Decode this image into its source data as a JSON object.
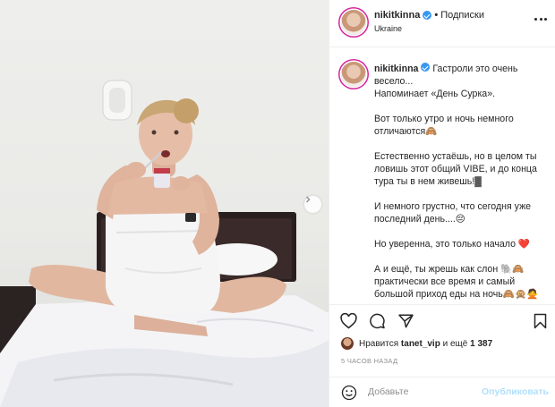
{
  "post_header": {
    "username": "nikitkinna",
    "separator": "•",
    "follow_status": "Подписки",
    "location": "Ukraine"
  },
  "caption": {
    "username": "nikitkinna",
    "paragraphs": [
      "Гастроли это очень весело...\nНапоминает «День Сурка».",
      "Вот только утро и ночь немного отличаются🙈",
      "Естественно устаёшь, но в целом ты ловишь этот общий VIBE, и до конца тура ты в нем живешь!▓",
      "И немного грустно, что сегодня уже последний день....😔",
      "Но уверенна, это только начало ❤️",
      "А и ещё, ты жрешь как слон 🐘🙈 практически все время и самый большой приход еды на ночь🙈🙊🙅"
    ]
  },
  "likes": {
    "prefix": "Нравится",
    "user": "tanet_vip",
    "middle": "и ещё",
    "count": "1 387"
  },
  "timestamp": "5 часов назад",
  "comment": {
    "placeholder": "Добавьте",
    "publish_label": "Опубликовать"
  },
  "icons": {
    "verified": "verified-badge-icon",
    "more": "more-options-icon",
    "like": "heart-icon",
    "comment": "comment-icon",
    "share": "paper-plane-icon",
    "save": "bookmark-icon",
    "emoji": "emoji-smile-icon",
    "next": "chevron-right-icon"
  },
  "colors": {
    "verified": "#3897f0",
    "publish_disabled": "#b2dffc",
    "muted_text": "#8e8e8e",
    "divider": "#efefef"
  }
}
